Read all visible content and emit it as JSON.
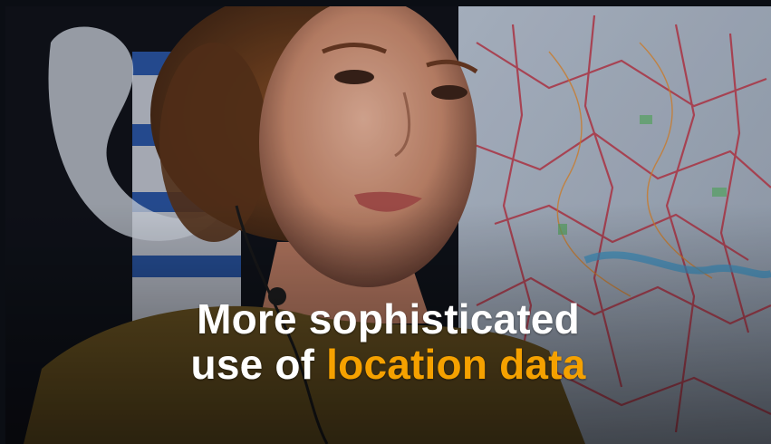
{
  "caption": {
    "line1": "More sophisticated",
    "line2_prefix": "use of",
    "line2_highlight": "location data"
  },
  "colors": {
    "highlight": "#f5a100",
    "text": "#ffffff",
    "background": "#0b0e14"
  }
}
